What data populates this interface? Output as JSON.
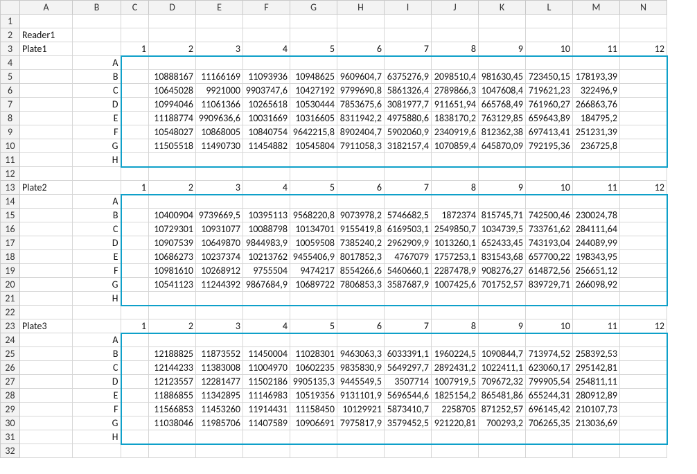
{
  "cols": [
    "A",
    "B",
    "C",
    "D",
    "E",
    "F",
    "G",
    "H",
    "I",
    "J",
    "K",
    "L",
    "M",
    "N"
  ],
  "rows": 32,
  "text": {
    "reader": "Reader1"
  },
  "plates": [
    {
      "name": "Plate1",
      "startRow": 3
    },
    {
      "name": "Plate2",
      "startRow": 13
    },
    {
      "name": "Plate3",
      "startRow": 23
    }
  ],
  "colHeaders": [
    "1",
    "2",
    "3",
    "4",
    "5",
    "6",
    "7",
    "8",
    "9",
    "10",
    "11",
    "12"
  ],
  "rowLabels": [
    "A",
    "B",
    "C",
    "D",
    "E",
    "F",
    "G",
    "H"
  ],
  "chart_data": [
    {
      "type": "table",
      "title": "Plate1",
      "rows": [
        "A",
        "B",
        "C",
        "D",
        "E",
        "F",
        "G",
        "H"
      ],
      "cols": [
        "1",
        "2",
        "3",
        "4",
        "5",
        "6",
        "7",
        "8",
        "9",
        "10",
        "11",
        "12"
      ],
      "values": [
        [
          "",
          "",
          "",
          "",
          "",
          "",
          "",
          "",
          "",
          "",
          "",
          ""
        ],
        [
          "",
          "10888167",
          "11166169",
          "11093936",
          "10948625",
          "9609604,7",
          "6375276,9",
          "2098510,4",
          "981630,45",
          "723450,15",
          "178193,39",
          ""
        ],
        [
          "",
          "10645028",
          "9921000",
          "9903747,6",
          "10427192",
          "9799690,8",
          "5861326,4",
          "2789866,3",
          "1047608,4",
          "719621,23",
          "322496,9",
          ""
        ],
        [
          "",
          "10994046",
          "11061366",
          "10265618",
          "10530444",
          "7853675,6",
          "3081977,7",
          "911651,94",
          "665768,49",
          "761960,27",
          "266863,76",
          ""
        ],
        [
          "",
          "11188774",
          "9909636,6",
          "10031669",
          "10316605",
          "8311942,2",
          "4975880,6",
          "1838170,2",
          "763129,85",
          "659643,89",
          "184795,2",
          ""
        ],
        [
          "",
          "10548027",
          "10868005",
          "10840754",
          "9642215,8",
          "8902404,7",
          "5902060,9",
          "2340919,6",
          "812362,38",
          "697413,41",
          "251231,39",
          ""
        ],
        [
          "",
          "11505518",
          "11490730",
          "11454882",
          "10545804",
          "7911058,3",
          "3182157,4",
          "1070859,4",
          "645870,09",
          "792195,36",
          "236725,8",
          ""
        ],
        [
          "",
          "",
          "",
          "",
          "",
          "",
          "",
          "",
          "",
          "",
          "",
          ""
        ]
      ]
    },
    {
      "type": "table",
      "title": "Plate2",
      "rows": [
        "A",
        "B",
        "C",
        "D",
        "E",
        "F",
        "G",
        "H"
      ],
      "cols": [
        "1",
        "2",
        "3",
        "4",
        "5",
        "6",
        "7",
        "8",
        "9",
        "10",
        "11",
        "12"
      ],
      "values": [
        [
          "",
          "",
          "",
          "",
          "",
          "",
          "",
          "",
          "",
          "",
          "",
          ""
        ],
        [
          "",
          "10400904",
          "9739669,5",
          "10395113",
          "9568220,8",
          "9073978,2",
          "5746682,5",
          "1872374",
          "815745,71",
          "742500,46",
          "230024,78",
          ""
        ],
        [
          "",
          "10729301",
          "10931077",
          "10088798",
          "10134701",
          "9155419,8",
          "6169503,1",
          "2549850,7",
          "1034739,5",
          "733761,62",
          "284111,64",
          ""
        ],
        [
          "",
          "10907539",
          "10649870",
          "9844983,9",
          "10059508",
          "7385240,2",
          "2962909,9",
          "1013260,1",
          "652433,45",
          "743193,04",
          "244089,99",
          ""
        ],
        [
          "",
          "10686273",
          "10237374",
          "10213762",
          "9455406,9",
          "8017852,3",
          "4767079",
          "1757253,1",
          "831543,68",
          "657700,22",
          "198343,95",
          ""
        ],
        [
          "",
          "10981610",
          "10268912",
          "9755504",
          "9474217",
          "8554266,6",
          "5460660,1",
          "2287478,9",
          "908276,27",
          "614872,56",
          "256651,12",
          ""
        ],
        [
          "",
          "10541123",
          "11244392",
          "9867684,9",
          "10689722",
          "7806853,3",
          "3587687,9",
          "1007425,6",
          "701752,57",
          "839729,71",
          "266098,92",
          ""
        ],
        [
          "",
          "",
          "",
          "",
          "",
          "",
          "",
          "",
          "",
          "",
          "",
          ""
        ]
      ]
    },
    {
      "type": "table",
      "title": "Plate3",
      "rows": [
        "A",
        "B",
        "C",
        "D",
        "E",
        "F",
        "G",
        "H"
      ],
      "cols": [
        "1",
        "2",
        "3",
        "4",
        "5",
        "6",
        "7",
        "8",
        "9",
        "10",
        "11",
        "12"
      ],
      "values": [
        [
          "",
          "",
          "",
          "",
          "",
          "",
          "",
          "",
          "",
          "",
          "",
          ""
        ],
        [
          "",
          "12188825",
          "11873552",
          "11450004",
          "11028301",
          "9463063,3",
          "6033391,1",
          "1960224,5",
          "1090844,7",
          "713974,52",
          "258392,53",
          ""
        ],
        [
          "",
          "12144233",
          "11383008",
          "11004970",
          "10602235",
          "9835830,9",
          "5649297,7",
          "2892431,2",
          "1022411,1",
          "623060,17",
          "295142,81",
          ""
        ],
        [
          "",
          "12123557",
          "12281477",
          "11502186",
          "9905135,3",
          "9445549,5",
          "3507714",
          "1007919,5",
          "709672,32",
          "799905,54",
          "254811,11",
          ""
        ],
        [
          "",
          "11886855",
          "11342895",
          "11146983",
          "10519356",
          "9131101,9",
          "5696544,6",
          "1825154,2",
          "865481,86",
          "655244,31",
          "280912,89",
          ""
        ],
        [
          "",
          "11566853",
          "11453260",
          "11914431",
          "11158450",
          "10129921",
          "5873410,7",
          "2258705",
          "871252,57",
          "696145,42",
          "210107,73",
          ""
        ],
        [
          "",
          "11038046",
          "11985706",
          "11407589",
          "10906691",
          "7975817,9",
          "3579452,5",
          "921220,81",
          "700293,2",
          "706265,35",
          "213036,69",
          ""
        ],
        [
          "",
          "",
          "",
          "",
          "",
          "",
          "",
          "",
          "",
          "",
          "",
          ""
        ]
      ]
    }
  ]
}
